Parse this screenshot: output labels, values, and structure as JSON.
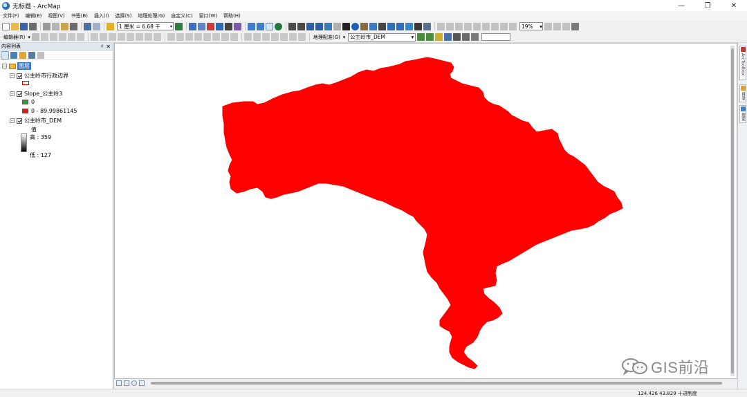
{
  "window": {
    "title": "无标题 - ArcMap",
    "minimize": "—",
    "maximize": "❐",
    "close": "✕"
  },
  "menu": [
    "文件(F)",
    "编辑(E)",
    "视图(V)",
    "书签(B)",
    "插入(I)",
    "选择(S)",
    "地理处理(G)",
    "自定义(C)",
    "窗口(W)",
    "帮助(H)"
  ],
  "toolbar": {
    "scale_value": "1 厘米 = 6.68 千",
    "zoom_value": "19%",
    "editor_label": "编辑器(R)",
    "georef_label": "地理配准(G)",
    "georef_layer": "公主岭市_DEM"
  },
  "toc": {
    "title": "内容列表",
    "pin": "♯",
    "close": "✕",
    "root_label": "图层",
    "layers": [
      {
        "name": "公主岭市行政边界"
      },
      {
        "name": "Slope_公主岭3",
        "classes": [
          {
            "label": "0",
            "color": "#2e9e2e"
          },
          {
            "label": "0 - 89.99861145",
            "color": "#e31a1a"
          }
        ]
      },
      {
        "name": "公主岭市_DEM",
        "field": "值",
        "high": "高 : 359",
        "low": "低 : 127"
      }
    ]
  },
  "right_dock": {
    "tabs": [
      "ArcToolbox",
      "目录",
      "搜索"
    ]
  },
  "status": {
    "coords": "124.426  43.829 十进制度"
  },
  "watermark": {
    "text": "GIS前沿"
  },
  "colors": {
    "region_fill": "#ff0000",
    "selection": "#3a78c6"
  }
}
